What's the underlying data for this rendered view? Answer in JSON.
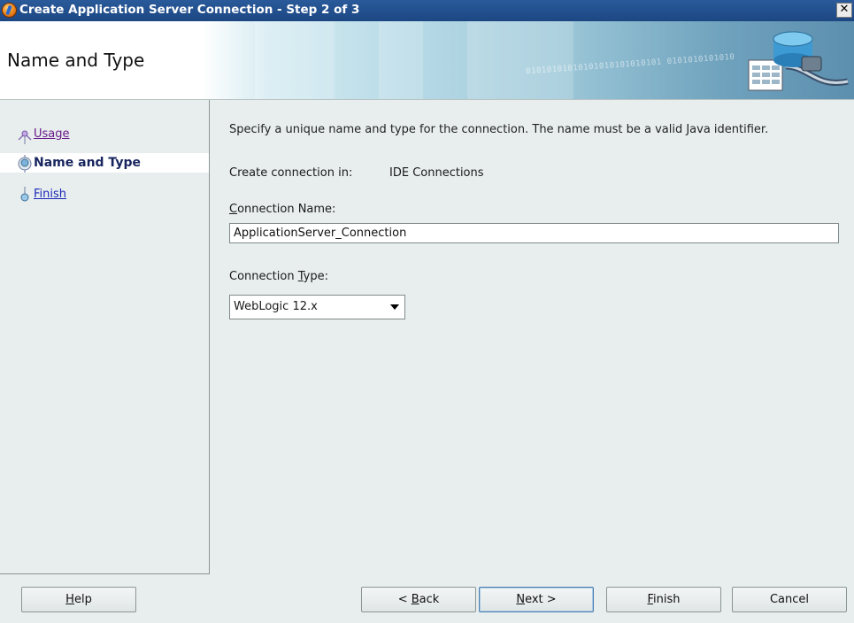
{
  "window": {
    "title": "Create Application Server Connection - Step 2 of 3",
    "close_glyph": "✕"
  },
  "header": {
    "page_title": "Name and Type",
    "banner_binary": "01010101010101010101010101 0101010101010"
  },
  "sidebar": {
    "steps": [
      {
        "label": "Usage",
        "state": "visited"
      },
      {
        "label": "Name and Type",
        "state": "current"
      },
      {
        "label": "Finish",
        "state": "pending"
      }
    ]
  },
  "main": {
    "intro": "Specify a unique name and type for the connection. The name must be a valid Java identifier.",
    "create_in_label": "Create connection in:",
    "create_in_value": "IDE Connections",
    "connection_name": {
      "label_mnemonic": "C",
      "label_rest": "onnection Name:",
      "value": "ApplicationServer_Connection"
    },
    "connection_type": {
      "label_prefix": "Connection ",
      "label_mnemonic": "T",
      "label_rest": "ype:",
      "selected": "WebLogic 12.x"
    }
  },
  "buttons": {
    "help": {
      "mnemonic": "H",
      "rest": "elp"
    },
    "back": {
      "prefix": "< ",
      "mnemonic": "B",
      "rest": "ack"
    },
    "next": {
      "mnemonic": "N",
      "rest": "ext >"
    },
    "finish": {
      "mnemonic": "F",
      "rest": "inish"
    },
    "cancel": "Cancel"
  },
  "colors": {
    "titlebar": "#1c4783",
    "link": "#1b27b8",
    "visited_link": "#6a1b8a",
    "current_step": "#17245e",
    "panel_bg": "#e8eeee"
  }
}
